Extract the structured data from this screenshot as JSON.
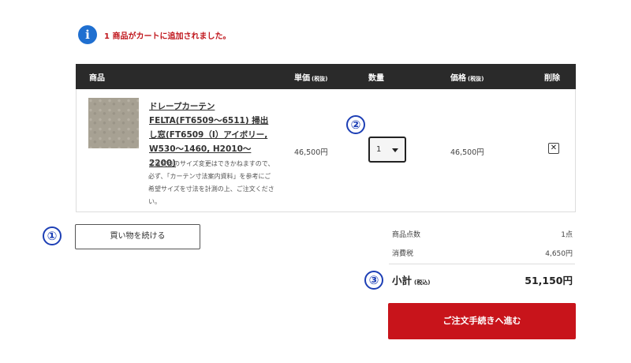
{
  "notice": {
    "icon": "info-icon",
    "icon_glyph": "i",
    "text": "1 商品がカートに追加されました。",
    "color": "#c0161c"
  },
  "table": {
    "headers": {
      "product": "商品",
      "unit_price": "単価",
      "unit_price_note": "(税抜)",
      "quantity": "数量",
      "price": "価格",
      "price_note": "(税抜)",
      "delete": "削除"
    },
    "rows": [
      {
        "name": "ドレープカーテン FELTA(FT6509～6511) 掃出し窓(FT6509（I）アイボリー, W530～1460, H2010～2200)",
        "note": "ご注文後のサイズ変更はできかねますので、必ず、「カーテン寸法案内資料」を参考にご希望サイズを寸法を計測の上、ご注文ください。",
        "unit_price": "46,500円",
        "quantity": "1",
        "price": "46,500円",
        "delete_icon": "close-box-icon",
        "delete_glyph": "✕"
      }
    ]
  },
  "markers": [
    "①",
    "②",
    "③"
  ],
  "continue_label": "買い物を続ける",
  "summary": {
    "item_count_label": "商品点数",
    "item_count_value": "1点",
    "tax_label": "消費税",
    "tax_value": "4,650円",
    "subtotal_label": "小計",
    "subtotal_note": "(税込)",
    "subtotal_value": "51,150円"
  },
  "checkout_label": "ご注文手続きへ進む",
  "colors": {
    "accent_red": "#c8141b",
    "header_bg": "#2a2a2a",
    "marker_blue": "#1d3fb5",
    "info_blue": "#1f6fd0"
  }
}
